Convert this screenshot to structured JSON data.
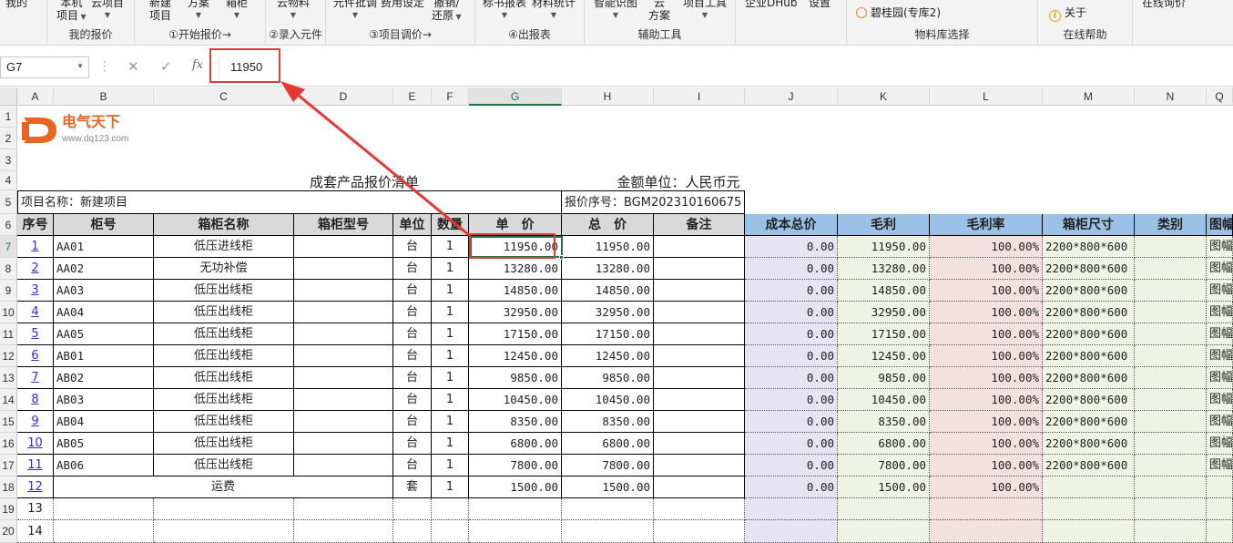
{
  "ribbon": {
    "g1_btn1": "我的",
    "g2_btn1": "本机",
    "g2_btn1b": "项目",
    "g2_btn2": "云项目",
    "g2_label": "我的报价",
    "g3_btn1": "新建",
    "g3_btn1b": "项目",
    "g3_btn2": "方案",
    "g3_btn3": "箱柜",
    "g3_label": "①开始报价→",
    "g4_btn1": "云物料",
    "g4_label": "②录入元件",
    "g5_btn1": "元件批调",
    "g5_btn2": "费用设定",
    "g5_btn3": "撤销/",
    "g5_btn3b": "还原",
    "g5_label": "③项目调价→",
    "g6_btn1": "标书报表",
    "g6_btn2": "材料统计",
    "g6_label": "④出报表",
    "g7_btn1": "智能识图",
    "g7_btn2": "云",
    "g7_btn2b": "方案",
    "g7_btn3": "项目工具",
    "g7_label": "辅助工具",
    "g8_btn1": "企业DHub",
    "g8_btn2": "设置",
    "g9_radio": "碧桂园(专库2)",
    "g9_label": "物料库选择",
    "g10_btn": "关于",
    "g10_label": "在线帮助",
    "g11_btn": "在线询价"
  },
  "formula_bar": {
    "name_box": "G7",
    "formula_value": "11950"
  },
  "columns": [
    "A",
    "B",
    "C",
    "D",
    "E",
    "F",
    "G",
    "H",
    "I",
    "J",
    "K",
    "L",
    "M",
    "N",
    "Q"
  ],
  "row_numbers": [
    "1",
    "2",
    "3",
    "4",
    "5",
    "6",
    "7",
    "8",
    "9",
    "10",
    "11",
    "12",
    "13",
    "14",
    "15",
    "16",
    "17",
    "18",
    "19",
    "20"
  ],
  "logo": {
    "name": "电气天下",
    "url": "www.dq123.com"
  },
  "sheet": {
    "title": "成套产品报价清单",
    "currency": "金额单位：人民币元",
    "project_name": "项目名称：新建项目",
    "quote_no": "报价序号：BGM202310160675",
    "headers": [
      "序号",
      "柜号",
      "箱柜名称",
      "箱柜型号",
      "单位",
      "数量",
      "单　价",
      "总　价",
      "备注",
      "成本总价",
      "毛利",
      "毛利率",
      "箱柜尺寸",
      "类别",
      "图幅"
    ],
    "rows": [
      [
        "1",
        "AA01",
        "低压进线柜",
        "",
        "台",
        "1",
        "11950.00",
        "11950.00",
        "",
        "0.00",
        "11950.00",
        "100.00%",
        "2200*800*600",
        "",
        "图幅"
      ],
      [
        "2",
        "AA02",
        "无功补偿",
        "",
        "台",
        "1",
        "13280.00",
        "13280.00",
        "",
        "0.00",
        "13280.00",
        "100.00%",
        "2200*800*600",
        "",
        "图幅"
      ],
      [
        "3",
        "AA03",
        "低压出线柜",
        "",
        "台",
        "1",
        "14850.00",
        "14850.00",
        "",
        "0.00",
        "14850.00",
        "100.00%",
        "2200*800*600",
        "",
        "图幅"
      ],
      [
        "4",
        "AA04",
        "低压出线柜",
        "",
        "台",
        "1",
        "32950.00",
        "32950.00",
        "",
        "0.00",
        "32950.00",
        "100.00%",
        "2200*800*600",
        "",
        "图幅"
      ],
      [
        "5",
        "AA05",
        "低压出线柜",
        "",
        "台",
        "1",
        "17150.00",
        "17150.00",
        "",
        "0.00",
        "17150.00",
        "100.00%",
        "2200*800*600",
        "",
        "图幅"
      ],
      [
        "6",
        "AB01",
        "低压出线柜",
        "",
        "台",
        "1",
        "12450.00",
        "12450.00",
        "",
        "0.00",
        "12450.00",
        "100.00%",
        "2200*800*600",
        "",
        "图幅"
      ],
      [
        "7",
        "AB02",
        "低压出线柜",
        "",
        "台",
        "1",
        "9850.00",
        "9850.00",
        "",
        "0.00",
        "9850.00",
        "100.00%",
        "2200*800*600",
        "",
        "图幅"
      ],
      [
        "8",
        "AB03",
        "低压出线柜",
        "",
        "台",
        "1",
        "10450.00",
        "10450.00",
        "",
        "0.00",
        "10450.00",
        "100.00%",
        "2200*800*600",
        "",
        "图幅"
      ],
      [
        "9",
        "AB04",
        "低压出线柜",
        "",
        "台",
        "1",
        "8350.00",
        "8350.00",
        "",
        "0.00",
        "8350.00",
        "100.00%",
        "2200*800*600",
        "",
        "图幅"
      ],
      [
        "10",
        "AB05",
        "低压出线柜",
        "",
        "台",
        "1",
        "6800.00",
        "6800.00",
        "",
        "0.00",
        "6800.00",
        "100.00%",
        "2200*800*600",
        "",
        "图幅"
      ],
      [
        "11",
        "AB06",
        "低压出线柜",
        "",
        "台",
        "1",
        "7800.00",
        "7800.00",
        "",
        "0.00",
        "7800.00",
        "100.00%",
        "2200*800*600",
        "",
        "图幅"
      ]
    ],
    "freight_row": [
      "12",
      "运费",
      "套",
      "1",
      "1500.00",
      "1500.00",
      "0.00",
      "1500.00",
      "100.00%"
    ],
    "extra_rows": [
      "13",
      "14"
    ]
  },
  "colors": {
    "highlight": "#e53935",
    "selection": "#217346",
    "header_blue": "#9bc2e6",
    "cost_bg": "#e6e3f2",
    "profit_bg": "#eef3e4",
    "rate_bg": "#f3e1e1"
  }
}
